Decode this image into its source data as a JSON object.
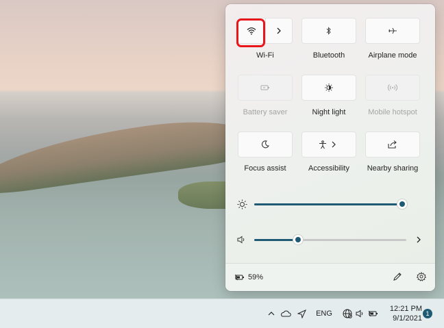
{
  "quick_settings": {
    "tiles": [
      {
        "id": "wifi",
        "label": "Wi-Fi",
        "icon": "wifi-icon",
        "enabled": true
      },
      {
        "id": "bluetooth",
        "label": "Bluetooth",
        "icon": "bluetooth-icon",
        "enabled": true
      },
      {
        "id": "airplane",
        "label": "Airplane mode",
        "icon": "airplane-icon",
        "enabled": true
      },
      {
        "id": "battery_saver",
        "label": "Battery saver",
        "icon": "battery-saver-icon",
        "enabled": false
      },
      {
        "id": "night_light",
        "label": "Night light",
        "icon": "night-light-icon",
        "enabled": true
      },
      {
        "id": "mobile_hotspot",
        "label": "Mobile hotspot",
        "icon": "hotspot-icon",
        "enabled": false
      },
      {
        "id": "focus_assist",
        "label": "Focus assist",
        "icon": "moon-icon",
        "enabled": true
      },
      {
        "id": "accessibility",
        "label": "Accessibility",
        "icon": "accessibility-icon",
        "enabled": true
      },
      {
        "id": "nearby_sharing",
        "label": "Nearby sharing",
        "icon": "share-icon",
        "enabled": true
      }
    ],
    "brightness": {
      "icon": "sun-icon",
      "value": 100
    },
    "volume": {
      "icon": "speaker-icon",
      "value": 29
    },
    "battery": {
      "percent": "59%",
      "icon": "battery-charging-icon"
    },
    "accent_color": "#1f5a74",
    "highlight_color": "#e8151b"
  },
  "taskbar": {
    "tray_icons": [
      "chevron-up-icon",
      "onedrive-cloud-icon",
      "location-icon"
    ],
    "language": "ENG",
    "status_icons": [
      "network-icon",
      "speaker-icon",
      "battery-icon"
    ],
    "time": "12:21 PM",
    "date": "9/1/2021",
    "notification_count": "1"
  }
}
